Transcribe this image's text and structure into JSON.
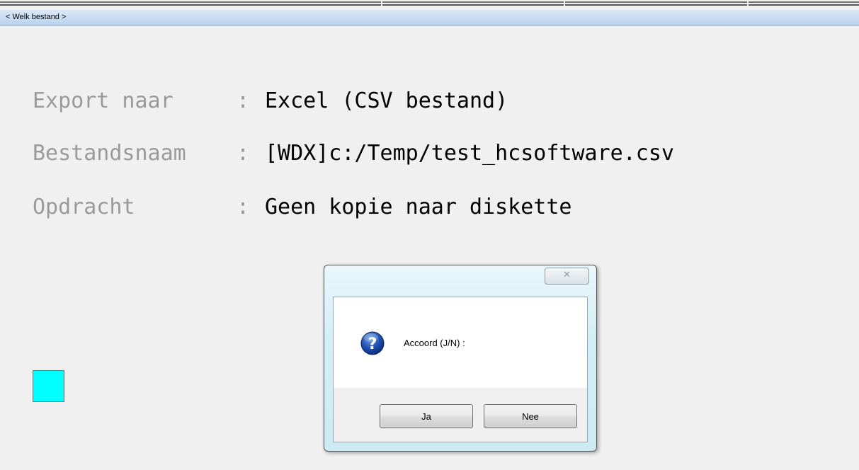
{
  "window": {
    "title": "< Welk bestand >"
  },
  "fields": [
    {
      "label": "Export naar",
      "colon": ":",
      "value": "Excel (CSV bestand)"
    },
    {
      "label": "Bestandsnaam",
      "colon": ":",
      "value": "[WDX]c:/Temp/test_hcsoftware.csv"
    },
    {
      "label": "Opdracht",
      "colon": ":",
      "value": "Geen kopie naar diskette"
    }
  ],
  "indicator": {
    "color": "#00ffff"
  },
  "dialog": {
    "close_glyph": "✕",
    "icon": "question-icon",
    "message": "Accoord (J/N) :",
    "buttons": {
      "yes": "Ja",
      "no": "Nee"
    }
  },
  "colors": {
    "label": "#9a9a9a",
    "value": "#000000",
    "titlebar": "#c6dbf2"
  }
}
